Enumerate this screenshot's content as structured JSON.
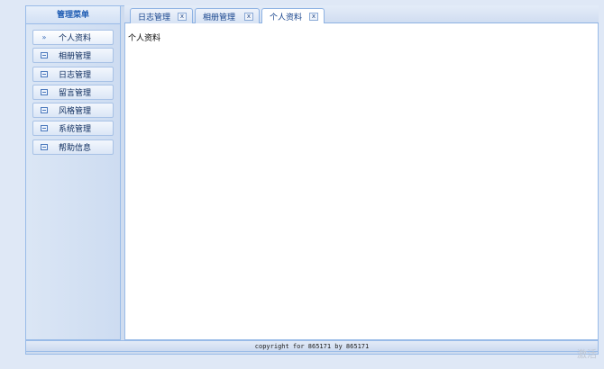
{
  "sidebar": {
    "title": "管理菜单",
    "items": [
      {
        "label": "个人资料",
        "icon": "double-chevron-right-icon",
        "active": true
      },
      {
        "label": "相册管理",
        "icon": "document-icon"
      },
      {
        "label": "日志管理",
        "icon": "document-icon"
      },
      {
        "label": "留言管理",
        "icon": "document-icon"
      },
      {
        "label": "风格管理",
        "icon": "document-icon"
      },
      {
        "label": "系统管理",
        "icon": "document-icon"
      },
      {
        "label": "帮助信息",
        "icon": "document-icon"
      }
    ]
  },
  "tabs": [
    {
      "label": "日志管理",
      "close": "x"
    },
    {
      "label": "相册管理",
      "close": "x"
    },
    {
      "label": "个人资料",
      "close": "x",
      "active": true
    }
  ],
  "content": {
    "text": "个人资料"
  },
  "footer": {
    "text": "copyright for 865171 by 865171"
  },
  "watermark": "激活",
  "colors": {
    "accent": "#15428b",
    "border": "#99bbe8",
    "background": "#dfe8f6"
  }
}
